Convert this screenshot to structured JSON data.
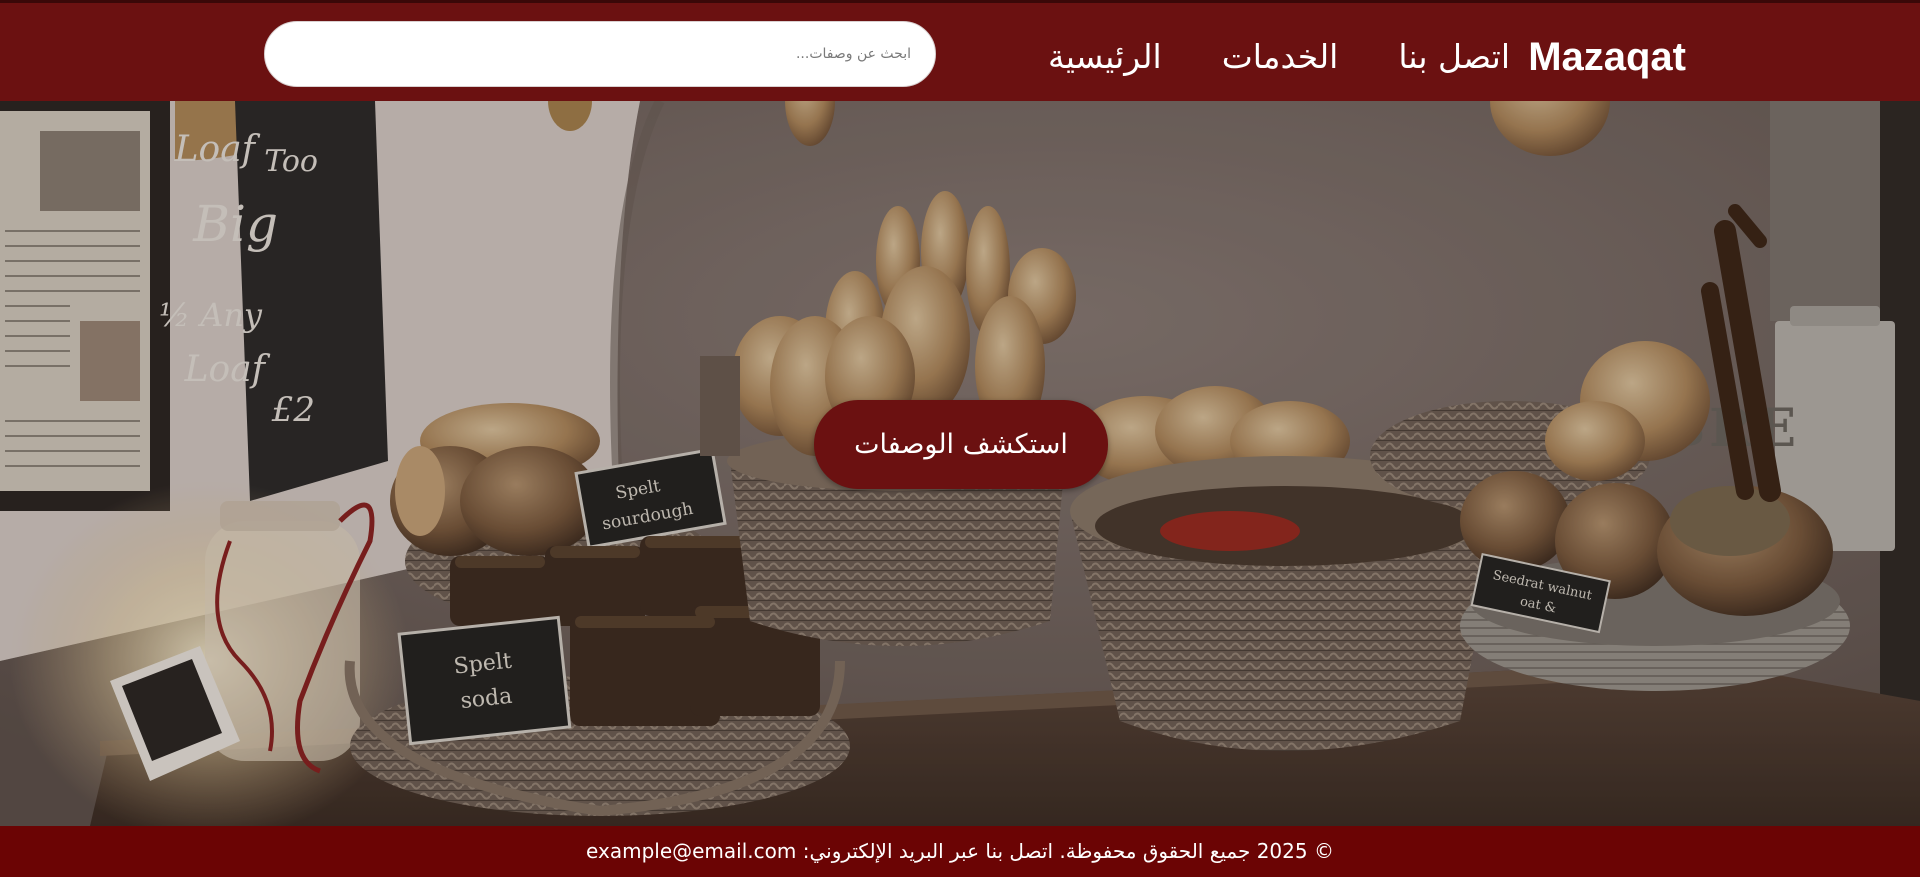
{
  "header": {
    "brand": "Mazaqat",
    "nav": {
      "home": "الرئيسية",
      "services": "الخدمات",
      "contact": "اتصل بنا"
    },
    "search": {
      "placeholder": "ابحث عن وصفات..."
    }
  },
  "hero": {
    "cta_label": "استكشف الوصفات",
    "image_text": {
      "chalkboard": [
        "Loaf",
        "Too",
        "Big",
        "Any ½",
        "Loaf",
        "£2"
      ],
      "sign_spelt_sourdough": [
        "Spelt",
        "sourdough"
      ],
      "sign_spelt_soda": [
        "Spelt",
        "soda"
      ],
      "sign_walnut": [
        "Seedrat walnut",
        "& oat"
      ],
      "bin_label": "BRE"
    }
  },
  "footer": {
    "text": "© 2025 جميع الحقوق محفوظة. اتصل بنا عبر البريد الإلكتروني: example@email.com"
  },
  "colors": {
    "brand": "#6b1111",
    "footer": "#6b0404",
    "text_on_brand": "#ffffff"
  }
}
